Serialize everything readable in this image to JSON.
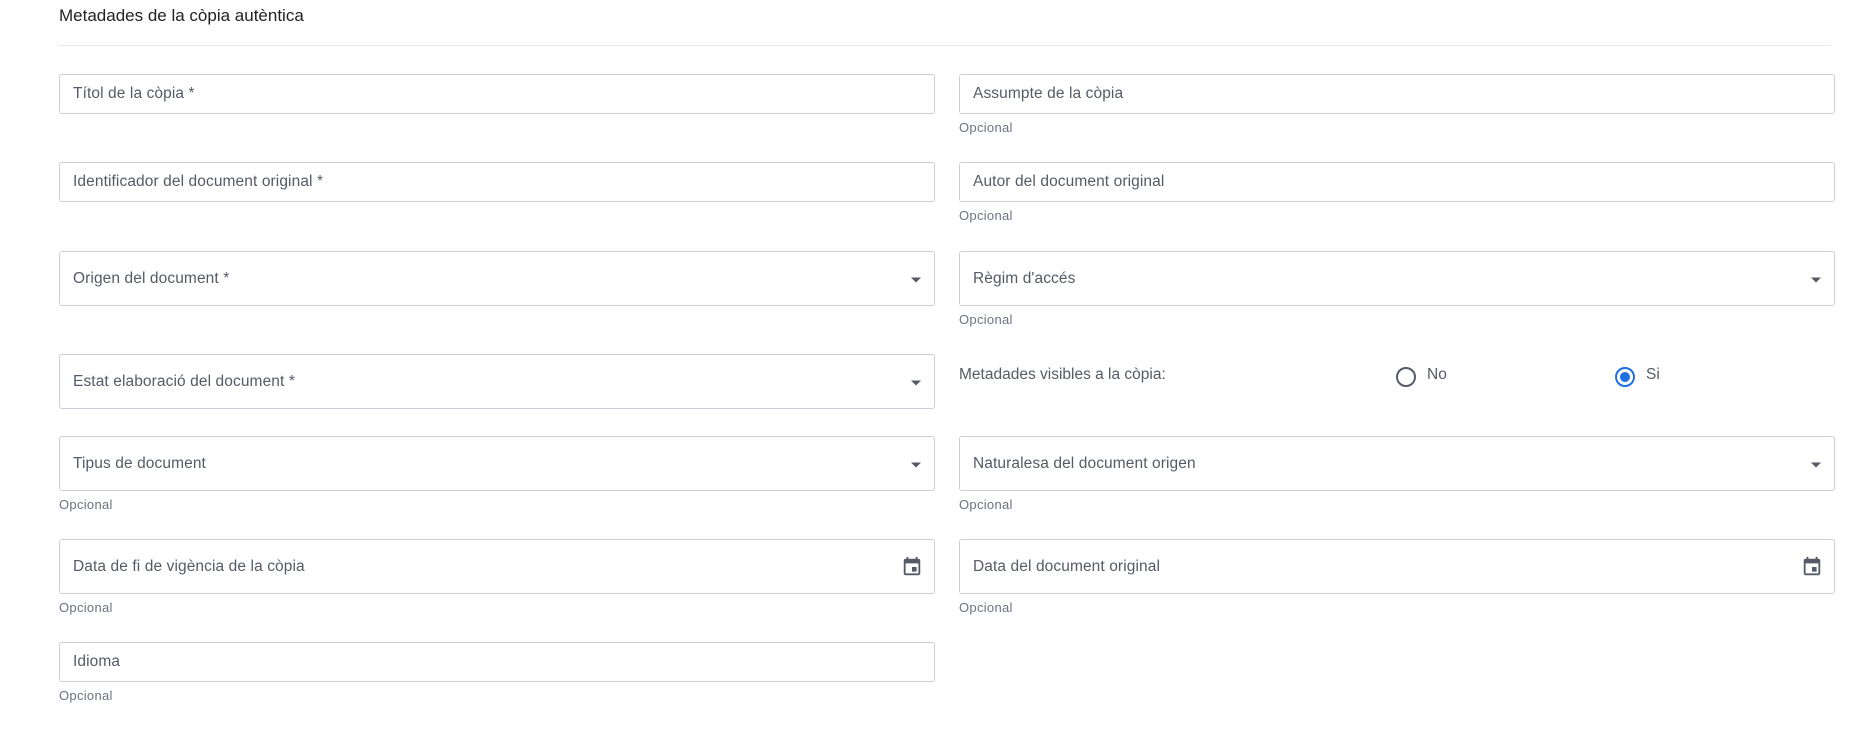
{
  "section": {
    "title": "Metadades de la còpia autèntica"
  },
  "fields": {
    "titol": {
      "label": "Títol de la còpia *"
    },
    "assumpte": {
      "label": "Assumpte de la còpia",
      "hint": "Opcional"
    },
    "identificador": {
      "label": "Identificador del document original *"
    },
    "autor": {
      "label": "Autor del document original",
      "hint": "Opcional"
    },
    "origen": {
      "label": "Origen del document *"
    },
    "regim": {
      "label": "Règim d'accés",
      "hint": "Opcional"
    },
    "estat": {
      "label": "Estat elaboració del document *"
    },
    "tipus": {
      "label": "Tipus de document",
      "hint": "Opcional"
    },
    "naturalesa": {
      "label": "Naturalesa del document origen",
      "hint": "Opcional"
    },
    "data_fi": {
      "label": "Data de fi de vigència de la còpia",
      "hint": "Opcional"
    },
    "data_doc": {
      "label": "Data del document original",
      "hint": "Opcional"
    },
    "idioma": {
      "label": "Idioma",
      "hint": "Opcional"
    }
  },
  "metadades_visibles": {
    "label": "Metadades visibles a la còpia:",
    "options": [
      {
        "label": "No",
        "selected": false
      },
      {
        "label": "Si",
        "selected": true
      }
    ]
  },
  "colors": {
    "accent": "#1f6fe0",
    "border": "#c9ced6",
    "text": "#555a66"
  }
}
